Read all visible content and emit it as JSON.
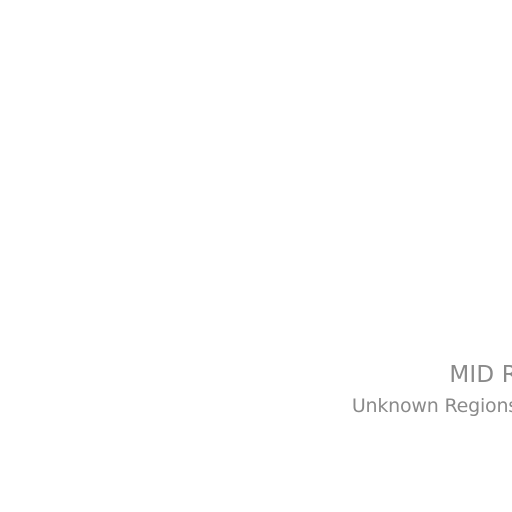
{
  "region": {
    "code": "MID R",
    "name": "Unknown Regions"
  },
  "colors": {
    "background": "#ffffff",
    "text": "#8a8a8a"
  }
}
